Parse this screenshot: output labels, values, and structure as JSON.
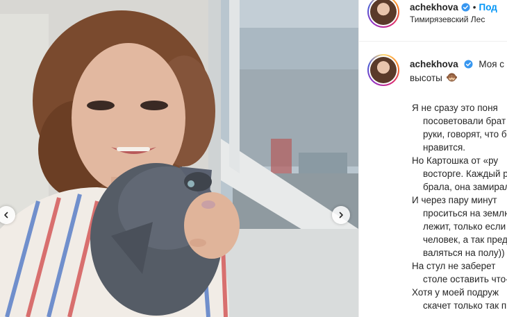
{
  "post": {
    "username": "achekhova",
    "separator": "•",
    "follow_label": "Под",
    "location": "Тимирязевский Лес"
  },
  "caption": {
    "username": "achekhova",
    "first_line": "Моя с",
    "second_line": "высоты",
    "body_lines": [
      {
        "text": "Я не сразу это поня",
        "indent": false
      },
      {
        "text": "посоветовали брат",
        "indent": true
      },
      {
        "text": "руки, говорят, что б",
        "indent": true
      },
      {
        "text": "нравится.",
        "indent": true
      },
      {
        "text": "Но Картошка от «ру",
        "indent": false
      },
      {
        "text": "восторге. Каждый р",
        "indent": true
      },
      {
        "text": "брала, она замирал",
        "indent": true
      },
      {
        "text": "И через пару минут",
        "indent": false
      },
      {
        "text": "проситься на землю",
        "indent": true
      },
      {
        "text": "лежит, только если",
        "indent": true
      },
      {
        "text": "человек, а так пред",
        "indent": true
      },
      {
        "text": "валяться на полу))",
        "indent": true
      },
      {
        "text": "На стул не заберет",
        "indent": false
      },
      {
        "text": "столе оставить что-",
        "indent": true
      },
      {
        "text": "Хотя у моей подруж",
        "indent": false
      },
      {
        "text": "скачет только так п",
        "indent": true
      }
    ]
  },
  "colors": {
    "link_blue": "#0095f6",
    "verified_blue": "#3897f0",
    "text": "#262626",
    "border": "#efefef"
  },
  "icons": {
    "verified": "verified-badge-icon",
    "prev": "chevron-left-icon",
    "next": "chevron-right-icon",
    "emoji": "see-no-evil-monkey-icon"
  }
}
